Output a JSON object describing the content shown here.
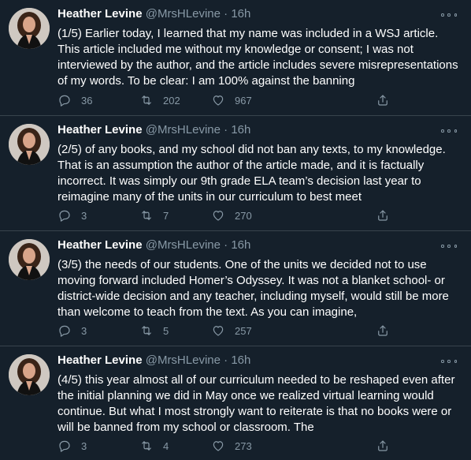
{
  "tweets": [
    {
      "name": "Heather Levine",
      "handle": "@MrsHLevine",
      "separator": "·",
      "time": "16h",
      "text": "(1/5) Earlier today, I learned that my name was included in a WSJ article. This article included me without my knowledge or consent; I was not interviewed by the author, and the article includes severe misrepresentations of my words. To be clear: I am 100% against the banning",
      "replies": "36",
      "retweets": "202",
      "likes": "967"
    },
    {
      "name": "Heather Levine",
      "handle": "@MrsHLevine",
      "separator": "·",
      "time": "16h",
      "text": "(2/5) of any books, and my school did not ban any texts, to my knowledge. That is an assumption the author of the article made, and it is factually incorrect. It was simply our 9th grade ELA team’s decision last year to reimagine many of the units in our curriculum to best meet",
      "replies": "3",
      "retweets": "7",
      "likes": "270"
    },
    {
      "name": "Heather Levine",
      "handle": "@MrsHLevine",
      "separator": "·",
      "time": "16h",
      "text": "(3/5) the needs of our students. One of the units we decided not to use moving forward included Homer’s Odyssey. It was not a blanket school- or district-wide decision and any teacher, including myself, would still be more than welcome to teach from the text. As you can imagine,",
      "replies": "3",
      "retweets": "5",
      "likes": "257"
    },
    {
      "name": "Heather Levine",
      "handle": "@MrsHLevine",
      "separator": "·",
      "time": "16h",
      "text": "(4/5) this year almost all of our curriculum needed to be reshaped even after the initial planning we did in May once we realized virtual learning would continue. But what I most strongly want to reiterate is that no books were or will be banned from my school or classroom. The",
      "replies": "3",
      "retweets": "4",
      "likes": "273"
    }
  ],
  "icons": {
    "reply": "reply-icon",
    "retweet": "retweet-icon",
    "like": "heart-icon",
    "share": "share-icon",
    "more": "more-icon"
  },
  "colors": {
    "background": "#15202b",
    "divider": "#38444d",
    "secondary_text": "#8899a6",
    "primary_text": "#ffffff"
  }
}
